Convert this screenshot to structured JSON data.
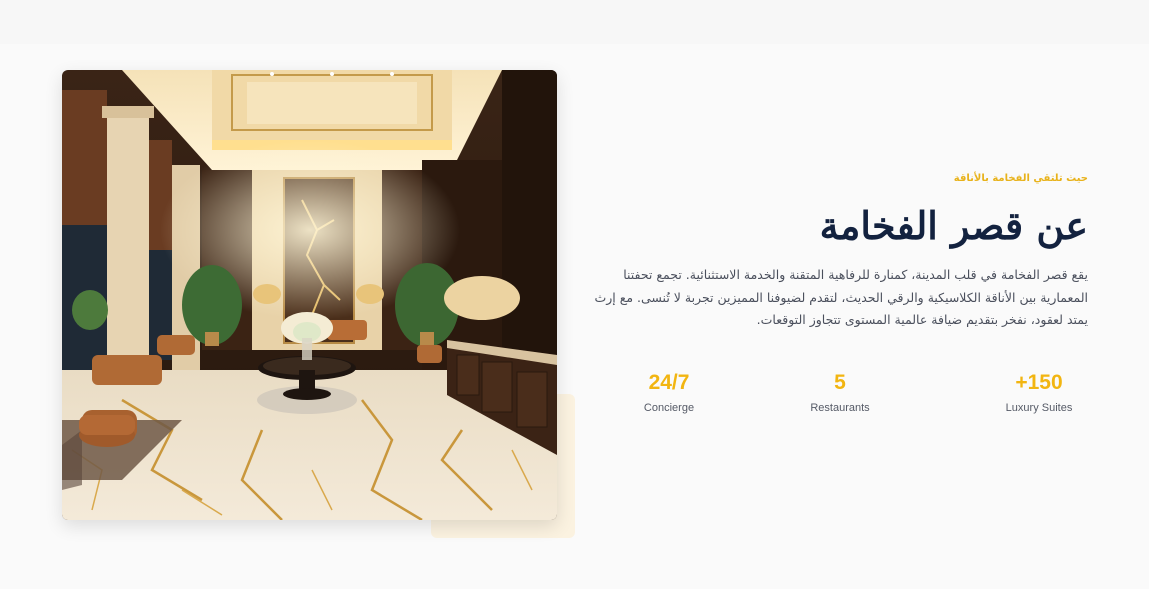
{
  "about": {
    "kicker": "حيث تلتقي الفخامة بالأناقة",
    "title": "عن قصر الفخامة",
    "description": "يقع قصر الفخامة في قلب المدينة، كمنارة للرفاهية المتقنة والخدمة الاستثنائية. تجمع تحفتنا المعمارية بين الأناقة الكلاسيكية والرقي الحديث، لتقدم لضيوفنا المميزين تجربة لا تُنسى. مع إرث يمتد لعقود، نفخر بتقديم ضيافة عالمية المستوى تتجاوز التوقعات."
  },
  "stats": [
    {
      "value": "+150",
      "label": "Luxury Suites"
    },
    {
      "value": "5",
      "label": "Restaurants"
    },
    {
      "value": "24/7",
      "label": "Concierge"
    }
  ],
  "colors": {
    "accent": "#f2b511",
    "heading": "#13223f",
    "body": "#4a4f5c",
    "deco": "#fbf2e0"
  }
}
